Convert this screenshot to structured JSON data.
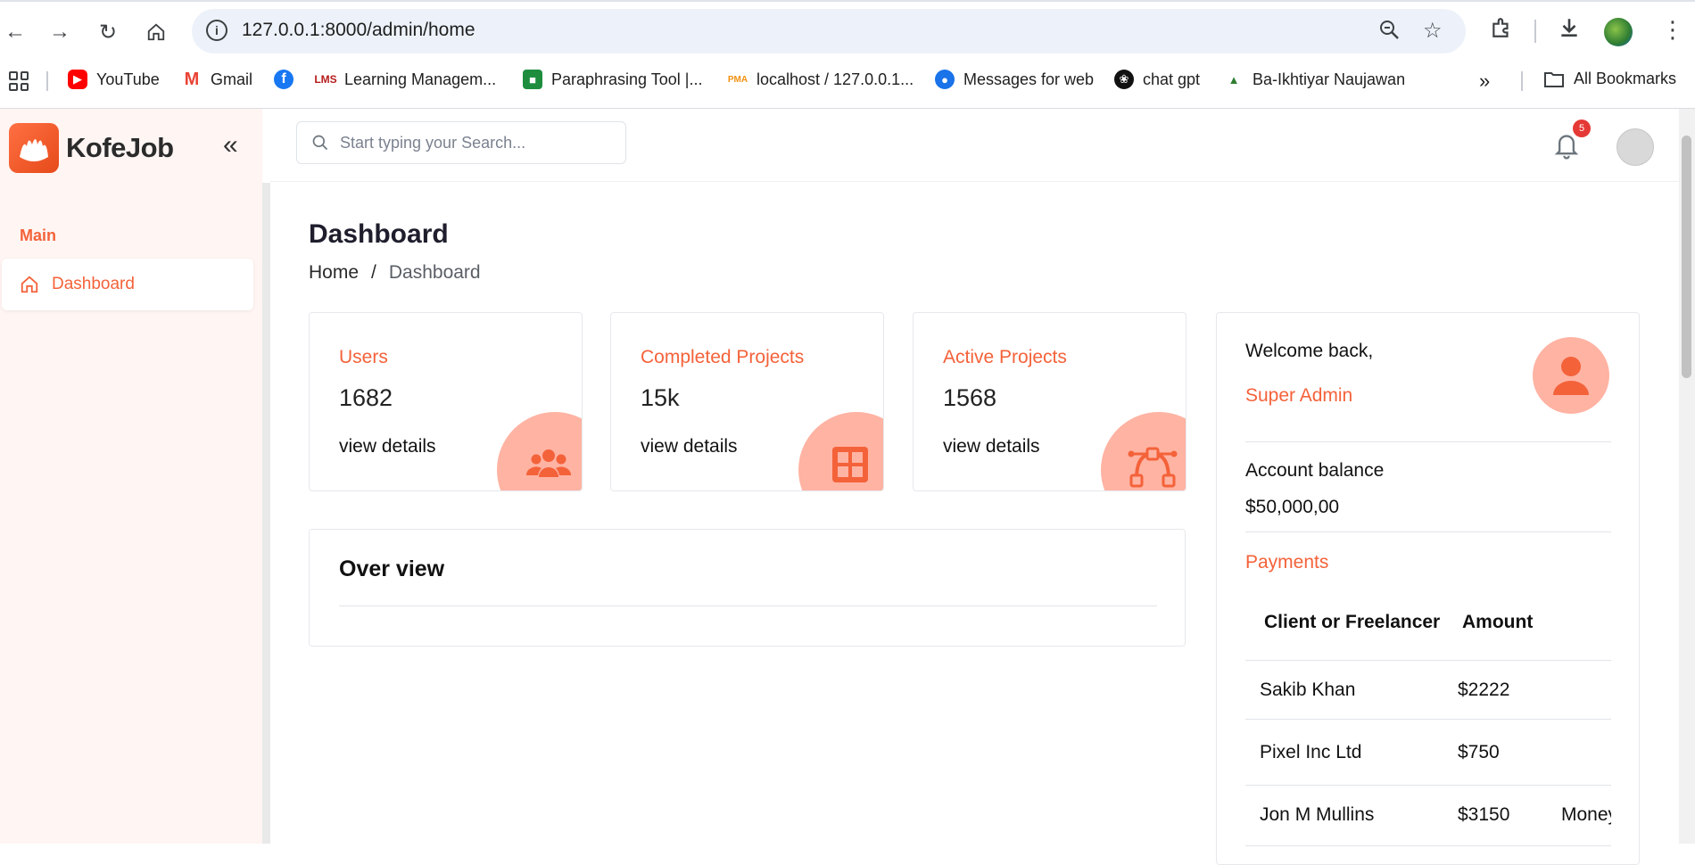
{
  "browser": {
    "url": "127.0.0.1:8000/admin/home",
    "bookmarks": [
      {
        "label": "YouTube",
        "icon": "youtube-icon",
        "color": "#ff0000"
      },
      {
        "label": "Gmail",
        "icon": "gmail-icon",
        "color": "#ea4335"
      },
      {
        "label": "",
        "icon": "facebook-icon",
        "color": "#1877f2"
      },
      {
        "label": "Learning Managem...",
        "icon": "lms-icon",
        "color": "#b71c1c"
      },
      {
        "label": "Paraphrasing Tool |...",
        "icon": "paraphrasing-icon",
        "color": "#1e8e3e"
      },
      {
        "label": "localhost / 127.0.0.1...",
        "icon": "phpmyadmin-icon",
        "color": "#f29111"
      },
      {
        "label": "Messages for web",
        "icon": "messages-icon",
        "color": "#1a73e8"
      },
      {
        "label": "chat gpt",
        "icon": "chatgpt-icon",
        "color": "#111111"
      },
      {
        "label": "Ba-Ikhtiyar Naujawan",
        "icon": "ba-ikhtiyar-icon",
        "color": "#2e7d32"
      }
    ],
    "all_bookmarks": "All Bookmarks"
  },
  "app": {
    "brand": "KofeJob",
    "accent": "#f4623a",
    "sidebar": {
      "section": "Main",
      "items": [
        {
          "label": "Dashboard",
          "icon": "home-icon"
        }
      ]
    },
    "search_placeholder": "Start typing your Search...",
    "notification_count": "5"
  },
  "page": {
    "title": "Dashboard",
    "breadcrumb": {
      "home": "Home",
      "separator": "/",
      "current": "Dashboard"
    }
  },
  "stats": [
    {
      "label": "Users",
      "value": "1682",
      "link": "view details",
      "icon": "users-icon"
    },
    {
      "label": "Completed Projects",
      "value": "15k",
      "link": "view details",
      "icon": "grid-icon"
    },
    {
      "label": "Active Projects",
      "value": "1568",
      "link": "view details",
      "icon": "bezier-icon"
    }
  ],
  "overview": {
    "title": "Over view"
  },
  "welcome": {
    "greeting": "Welcome back,",
    "name": "Super Admin",
    "balance_label": "Account balance",
    "balance": "$50,000,00",
    "payments_title": "Payments",
    "columns": [
      "Client or Freelancer",
      "Amount"
    ],
    "rows": [
      {
        "name": "Sakib Khan",
        "amount": "$2222",
        "extra": ""
      },
      {
        "name": "Pixel Inc Ltd",
        "amount": "$750",
        "extra": ""
      },
      {
        "name": "Jon M Mullins",
        "amount": "$3150",
        "extra": "Money"
      }
    ]
  }
}
